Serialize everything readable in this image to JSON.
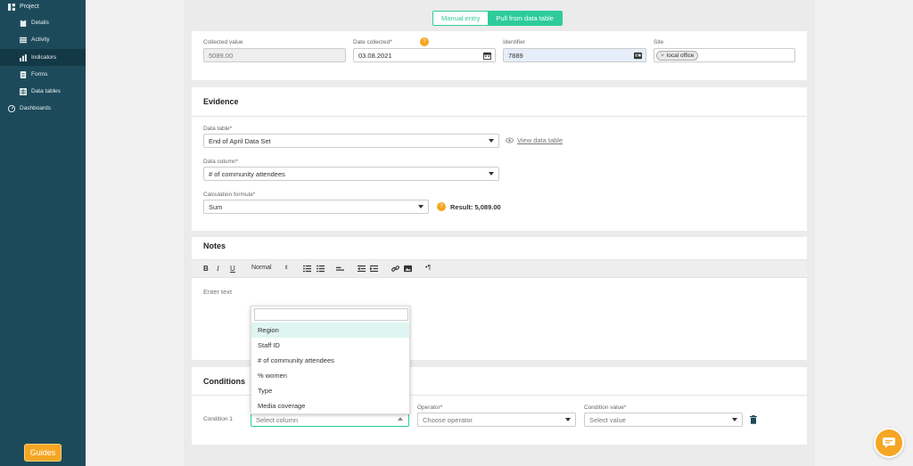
{
  "sidebar": {
    "items": [
      {
        "label": "Project",
        "icon": "grid-icon"
      },
      {
        "label": "Details",
        "icon": "clipboard-icon"
      },
      {
        "label": "Activity",
        "icon": "list-icon"
      },
      {
        "label": "Indicators",
        "icon": "bar-chart-icon"
      },
      {
        "label": "Forms",
        "icon": "form-icon"
      },
      {
        "label": "Data tables",
        "icon": "table-icon"
      },
      {
        "label": "Dashboards",
        "icon": "gauge-icon"
      }
    ],
    "guides_label": "Guides"
  },
  "toggle": {
    "manual": "Manual entry",
    "pull": "Pull from data table"
  },
  "top": {
    "collected_label": "Collected value",
    "collected_value": "5089.00",
    "date_label": "Date collected*",
    "date_value": "03.08.2021",
    "identifier_label": "Identifier",
    "identifier_value": "7889",
    "site_label": "Site",
    "site_chip": "local office"
  },
  "evidence": {
    "title": "Evidence",
    "table_label": "Data table*",
    "table_value": "End of April Data Set",
    "view_link": "View data table",
    "column_label": "Data column*",
    "column_value": "# of community attendees",
    "formula_label": "Calculation formula*",
    "formula_value": "Sum",
    "result": "Result: 5,089.00"
  },
  "notes": {
    "title": "Notes",
    "format_label": "Normal",
    "placeholder": "Enter text"
  },
  "conditions": {
    "title": "Conditions",
    "row_label": "Condition 1",
    "column_placeholder": "Select column",
    "operator_label": "Operator*",
    "operator_placeholder": "Choose operator",
    "value_label": "Condition value*",
    "value_placeholder": "Select value"
  },
  "dropdown": {
    "options": [
      "Region",
      "Staff ID",
      "# of community attendees",
      "% women",
      "Type",
      "Media coverage"
    ]
  },
  "colors": {
    "sidebar": "#1d4a5b",
    "accent": "#2ecc9a",
    "orange": "#f5a623"
  }
}
